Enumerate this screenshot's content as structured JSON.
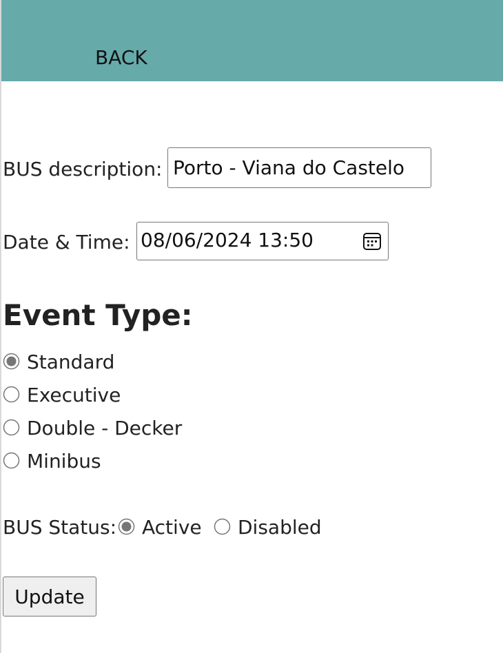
{
  "header": {
    "back_label": "BACK",
    "bar_color": "#66aaaa"
  },
  "form": {
    "description_label": "BUS description:",
    "description_value": "Porto - Viana do Castelo",
    "datetime_label": "Date & Time:",
    "datetime_value": "08/06/2024 13:50",
    "datetime_icon": "calendar-icon",
    "event_type_heading": "Event Type:",
    "event_types": [
      {
        "label": "Standard",
        "selected": true
      },
      {
        "label": "Executive",
        "selected": false
      },
      {
        "label": "Double - Decker",
        "selected": false
      },
      {
        "label": "Minibus",
        "selected": false
      }
    ],
    "status_label": "BUS Status:",
    "statuses": [
      {
        "label": "Active",
        "selected": true
      },
      {
        "label": "Disabled",
        "selected": false
      }
    ],
    "submit_label": "Update"
  }
}
